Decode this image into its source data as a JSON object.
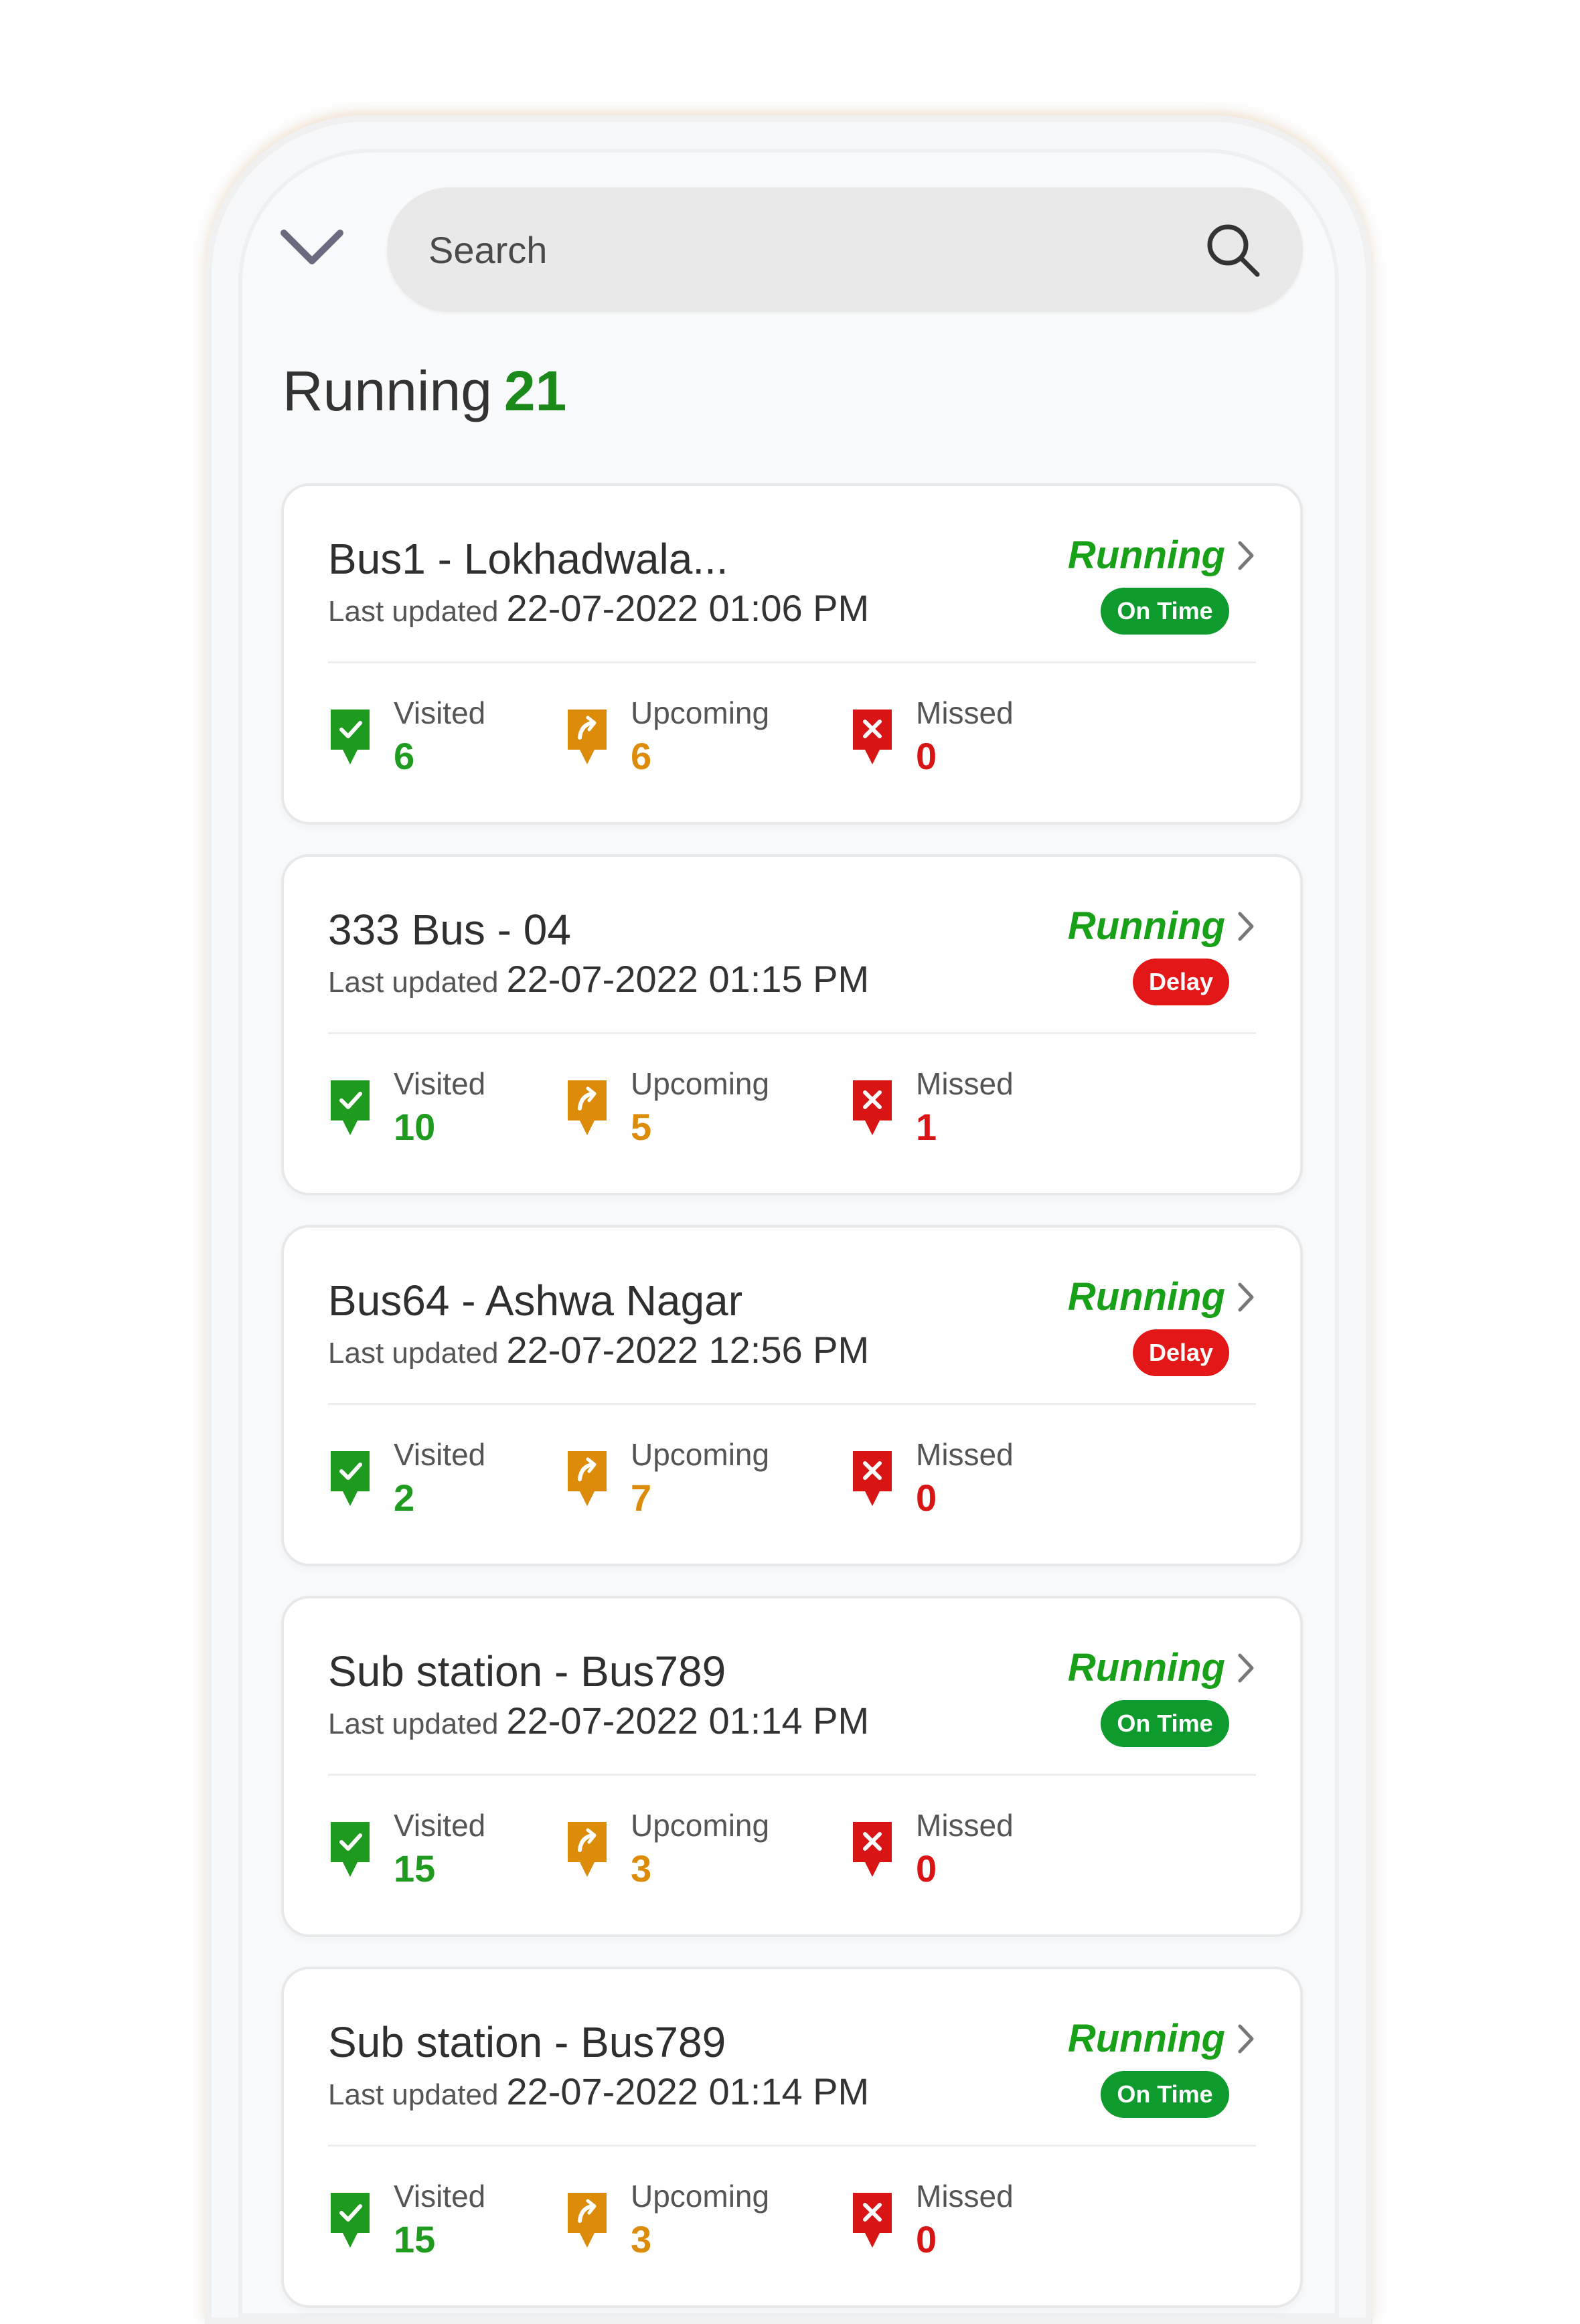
{
  "search": {
    "placeholder": "Search"
  },
  "header": {
    "running_label": "Running",
    "running_count": "21"
  },
  "labels": {
    "last_updated": "Last updated",
    "visited": "Visited",
    "upcoming": "Upcoming",
    "missed": "Missed"
  },
  "colors": {
    "green": "#1f9b1f",
    "orange": "#dd8c09",
    "red": "#d81414",
    "on_time_badge": "#0f9a2e",
    "delay_badge": "#e31717"
  },
  "trips": [
    {
      "name": "Bus1 - Lokhadwala...",
      "updated": "22-07-2022 01:06 PM",
      "status": "Running",
      "badge": "On Time",
      "badge_type": "ontime",
      "visited": "6",
      "upcoming": "6",
      "missed": "0"
    },
    {
      "name": "333 Bus - 04",
      "updated": "22-07-2022 01:15 PM",
      "status": "Running",
      "badge": "Delay",
      "badge_type": "delay",
      "visited": "10",
      "upcoming": "5",
      "missed": "1"
    },
    {
      "name": "Bus64 - Ashwa Nagar",
      "updated": "22-07-2022 12:56 PM",
      "status": "Running",
      "badge": "Delay",
      "badge_type": "delay",
      "visited": "2",
      "upcoming": "7",
      "missed": "0"
    },
    {
      "name": "Sub station - Bus789",
      "updated": "22-07-2022 01:14 PM",
      "status": "Running",
      "badge": "On Time",
      "badge_type": "ontime",
      "visited": "15",
      "upcoming": "3",
      "missed": "0"
    },
    {
      "name": "Sub station - Bus789",
      "updated": "22-07-2022 01:14 PM",
      "status": "Running",
      "badge": "On Time",
      "badge_type": "ontime",
      "visited": "15",
      "upcoming": "3",
      "missed": "0"
    }
  ]
}
